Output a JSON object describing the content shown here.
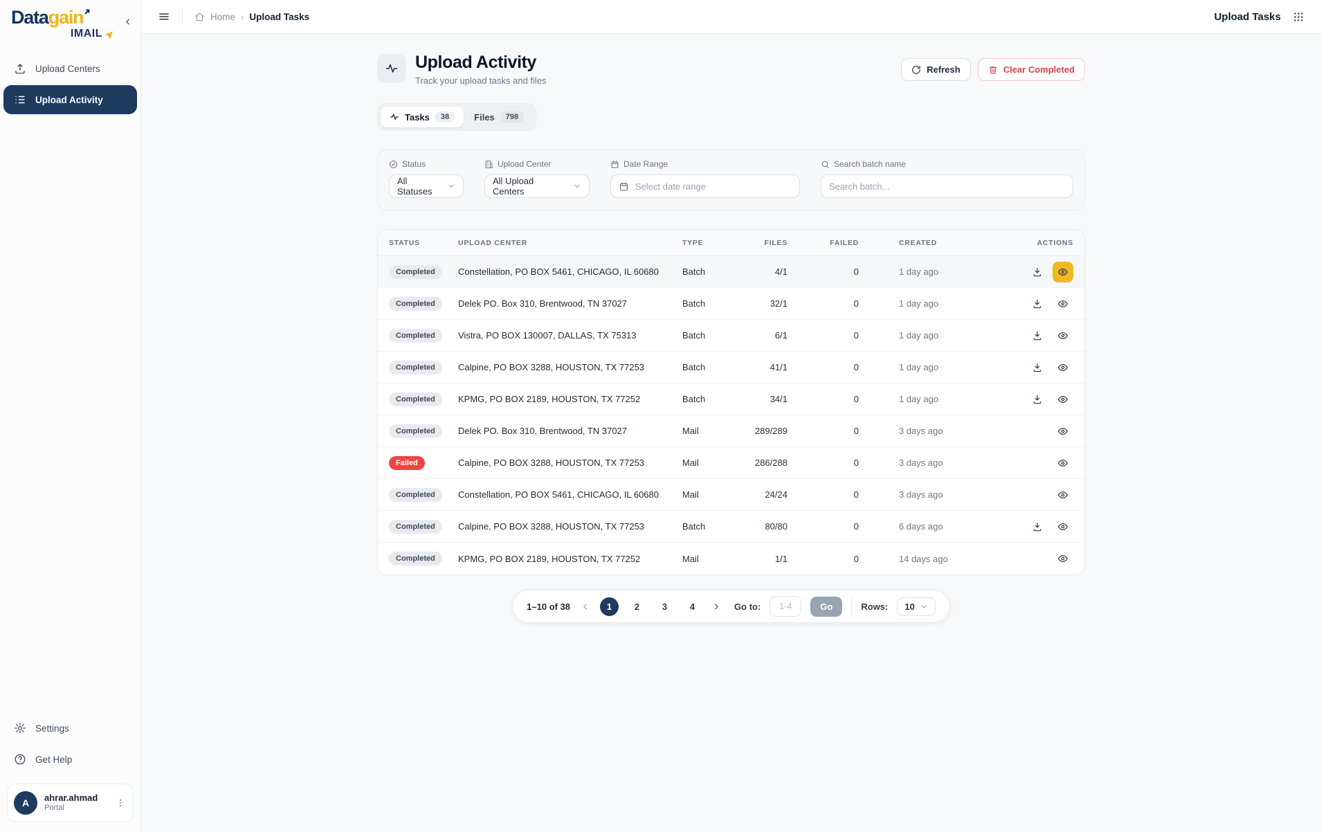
{
  "app": {
    "logo_primary": "Data",
    "logo_secondary": "gain",
    "logo_sub": "IMAIL",
    "topbar_title": "Upload Tasks"
  },
  "breadcrumb": {
    "home": "Home",
    "current": "Upload Tasks"
  },
  "sidebar": {
    "items": [
      {
        "label": "Upload Centers",
        "icon": "upload-icon",
        "active": false
      },
      {
        "label": "Upload Activity",
        "icon": "task-list-icon",
        "active": true
      }
    ],
    "footer_items": [
      {
        "label": "Settings",
        "icon": "gear-icon"
      },
      {
        "label": "Get Help",
        "icon": "help-circle-icon"
      }
    ],
    "user": {
      "initial": "A",
      "name": "ahrar.ahmad",
      "role": "Portal"
    }
  },
  "page": {
    "title": "Upload Activity",
    "subtitle": "Track your upload tasks and files",
    "refresh_label": "Refresh",
    "clear_label": "Clear Completed"
  },
  "tabs": [
    {
      "label": "Tasks",
      "count": "38",
      "active": true
    },
    {
      "label": "Files",
      "count": "798",
      "active": false
    }
  ],
  "filters": {
    "status": {
      "label": "Status",
      "value": "All Statuses"
    },
    "upload_center": {
      "label": "Upload Center",
      "value": "All Upload Centers"
    },
    "date_range": {
      "label": "Date Range",
      "placeholder": "Select date range"
    },
    "search": {
      "label": "Search batch name",
      "placeholder": "Search batch..."
    }
  },
  "table": {
    "columns": [
      "STATUS",
      "UPLOAD CENTER",
      "TYPE",
      "FILES",
      "FAILED",
      "CREATED",
      "ACTIONS"
    ],
    "rows": [
      {
        "status": "Completed",
        "center": "Constellation, PO BOX 5461, CHICAGO, IL 60680",
        "type": "Batch",
        "files": "4/1",
        "failed": "0",
        "created": "1 day ago",
        "download": true,
        "highlighted": true
      },
      {
        "status": "Completed",
        "center": "Delek PO. Box 310, Brentwood, TN 37027",
        "type": "Batch",
        "files": "32/1",
        "failed": "0",
        "created": "1 day ago",
        "download": true,
        "highlighted": false
      },
      {
        "status": "Completed",
        "center": "Vistra, PO BOX 130007, DALLAS, TX 75313",
        "type": "Batch",
        "files": "6/1",
        "failed": "0",
        "created": "1 day ago",
        "download": true,
        "highlighted": false
      },
      {
        "status": "Completed",
        "center": "Calpine, PO BOX 3288, HOUSTON, TX 77253",
        "type": "Batch",
        "files": "41/1",
        "failed": "0",
        "created": "1 day ago",
        "download": true,
        "highlighted": false
      },
      {
        "status": "Completed",
        "center": "KPMG, PO BOX 2189, HOUSTON, TX 77252",
        "type": "Batch",
        "files": "34/1",
        "failed": "0",
        "created": "1 day ago",
        "download": true,
        "highlighted": false
      },
      {
        "status": "Completed",
        "center": "Delek PO. Box 310, Brentwood, TN 37027",
        "type": "Mail",
        "files": "289/289",
        "failed": "0",
        "created": "3 days ago",
        "download": false,
        "highlighted": false
      },
      {
        "status": "Failed",
        "center": "Calpine, PO BOX 3288, HOUSTON, TX 77253",
        "type": "Mail",
        "files": "286/288",
        "failed": "0",
        "created": "3 days ago",
        "download": false,
        "highlighted": false
      },
      {
        "status": "Completed",
        "center": "Constellation, PO BOX 5461, CHICAGO, IL 60680",
        "type": "Mail",
        "files": "24/24",
        "failed": "0",
        "created": "3 days ago",
        "download": false,
        "highlighted": false
      },
      {
        "status": "Completed",
        "center": "Calpine, PO BOX 3288, HOUSTON, TX 77253",
        "type": "Batch",
        "files": "80/80",
        "failed": "0",
        "created": "6 days ago",
        "download": true,
        "highlighted": false
      },
      {
        "status": "Completed",
        "center": "KPMG, PO BOX 2189, HOUSTON, TX 77252",
        "type": "Mail",
        "files": "1/1",
        "failed": "0",
        "created": "14 days ago",
        "download": false,
        "highlighted": false
      }
    ]
  },
  "pagination": {
    "summary": "1–10 of 38",
    "pages": [
      "1",
      "2",
      "3",
      "4"
    ],
    "active_page": "1",
    "goto_label": "Go to:",
    "goto_placeholder": "1-4",
    "go_label": "Go",
    "rows_label": "Rows:",
    "rows_value": "10"
  },
  "icons": [
    "upload-icon",
    "task-list-icon",
    "gear-icon",
    "help-circle-icon",
    "kebab-icon",
    "collapse-chevron-icon",
    "hamburger-icon",
    "home-icon",
    "apps-grid-icon",
    "activity-pulse-icon",
    "refresh-icon",
    "trash-icon",
    "status-circle-icon",
    "building-icon",
    "calendar-icon",
    "search-icon",
    "chevron-down-icon",
    "download-icon",
    "eye-icon",
    "chevron-left-icon",
    "chevron-right-icon",
    "paper-plane-icon",
    "logo-arrow-icon"
  ],
  "colors": {
    "navy": "#1e3a5f",
    "logo_yellow": "#f0b41c",
    "highlight_amber": "#f2b824",
    "failed_red": "#ee4445",
    "danger_text": "#d4444c"
  }
}
